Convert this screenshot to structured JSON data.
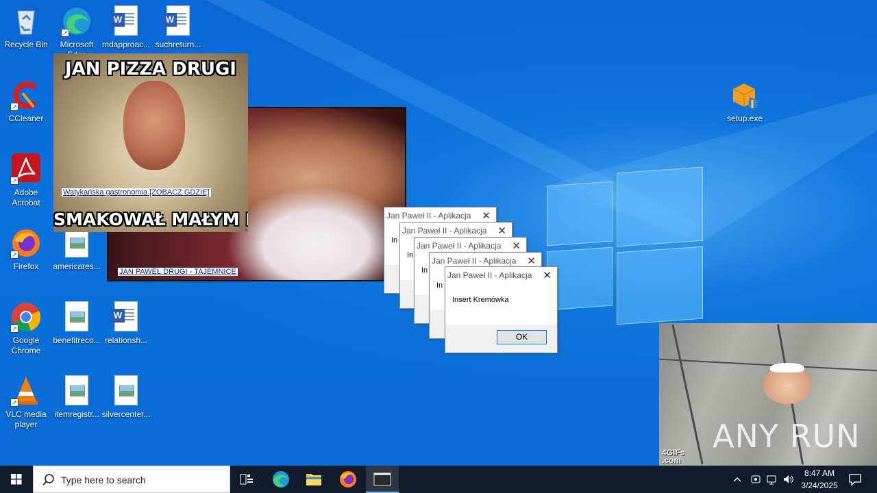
{
  "desktop_icons": [
    {
      "label": "Recycle Bin",
      "icon": "recycle-bin-icon"
    },
    {
      "label": "Microsoft Edge",
      "icon": "edge-icon"
    },
    {
      "label": "mdapproac...",
      "icon": "word-document-icon"
    },
    {
      "label": "suchreturn...",
      "icon": "word-document-icon"
    },
    {
      "label": "CCleaner",
      "icon": "ccleaner-icon"
    },
    {
      "label": "Adobe Acrobat",
      "icon": "acrobat-icon"
    },
    {
      "label": "Firefox",
      "icon": "firefox-icon"
    },
    {
      "label": "americares...",
      "icon": "image-file-icon"
    },
    {
      "label": "Google Chrome",
      "icon": "chrome-icon"
    },
    {
      "label": "benefitreco...",
      "icon": "image-file-icon"
    },
    {
      "label": "relationsh...",
      "icon": "word-document-icon"
    },
    {
      "label": "VLC media player",
      "icon": "vlc-icon"
    },
    {
      "label": "itemregistr...",
      "icon": "image-file-icon"
    },
    {
      "label": "silvercenter...",
      "icon": "image-file-icon"
    },
    {
      "label": "setup.exe",
      "icon": "setup-exe-icon"
    }
  ],
  "meme_window_1": {
    "caption": "JAN PAWEŁ DRUGI - TAJEMNICE"
  },
  "meme_window_2": {
    "top_text": "JAN PIZZA DRUGI",
    "bottom_text": "SMAKOWAŁ MAŁYM DZIECIOM",
    "caption": "Watykańska gastronomia [ZOBACZ GDZIE]"
  },
  "dialogs": [
    {
      "title": "Jan Paweł II - Aplikacja",
      "message": "In"
    },
    {
      "title": "Jan Paweł II - Aplikacja",
      "message": "In"
    },
    {
      "title": "Jan Paweł II - Aplikacja",
      "message": "In"
    },
    {
      "title": "Jan Paweł II - Aplikacja",
      "message": "In"
    },
    {
      "title": "Jan Paweł II - Aplikacja",
      "message": "Insert Kremówka",
      "ok_label": "OK"
    }
  ],
  "gif_overlay": {
    "watermark": "ANY RUN",
    "badge_line1": "4GIFs",
    "badge_line2": ".com"
  },
  "taskbar": {
    "search_placeholder": "Type here to search",
    "pinned": [
      "task-view-icon",
      "edge-icon",
      "file-explorer-icon",
      "firefox-icon",
      "app-window-icon"
    ],
    "clock_time": "8:47 AM",
    "clock_date": "3/24/2025"
  },
  "colors": {
    "desktop_blue": "#0a6bd4",
    "taskbar": "#101b2c",
    "link_blue": "#0a2aa0"
  }
}
